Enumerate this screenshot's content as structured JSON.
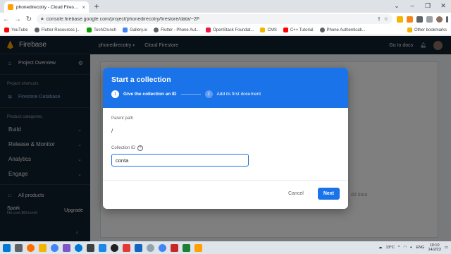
{
  "browser": {
    "tab_title": "phonedirecotry - Cloud Firestore",
    "url": "console.firebase.google.com/project/phonedirecotry/firestore/data/~2F",
    "bookmarks": [
      {
        "label": "YouTube",
        "color": "#ff0000"
      },
      {
        "label": "Flutter Resources |...",
        "color": "#5f6368"
      },
      {
        "label": "TechCrunch",
        "color": "#0a9e01"
      },
      {
        "label": "Gallery.io",
        "color": "#4285f4"
      },
      {
        "label": "Flutter - Phone Aut...",
        "color": "#5f6368"
      },
      {
        "label": "OpenStack Foundat...",
        "color": "#ed1944"
      },
      {
        "label": "CMS",
        "color": "#f4b400"
      },
      {
        "label": "C++ Tutorial",
        "color": "#ff0000"
      },
      {
        "label": "Phone Authenticati...",
        "color": "#5f6368"
      }
    ],
    "other_bookmarks": "Other bookmarks"
  },
  "sidebar": {
    "brand": "Firebase",
    "overview": "Project Overview",
    "shortcuts_label": "Project shortcuts",
    "firestore": "Firestore Database",
    "categories_label": "Product categories",
    "categories": [
      "Build",
      "Release & Monitor",
      "Analytics",
      "Engage"
    ],
    "all_products": "All products",
    "plan_name": "Spark",
    "plan_sub": "No-cost $0/month",
    "upgrade": "Upgrade"
  },
  "header": {
    "project": "phonedirecotry",
    "product": "Cloud Firestore",
    "docs": "Go to docs"
  },
  "main": {
    "no_data": "dd data."
  },
  "dialog": {
    "title": "Start a collection",
    "step1_num": "1",
    "step1_label": "Give the collection an ID",
    "step2_num": "2",
    "step2_label": "Add its first document",
    "parent_path_label": "Parent path",
    "parent_path_value": "/",
    "collection_id_label": "Collection ID",
    "help": "?",
    "collection_id_value": "conta",
    "cancel": "Cancel",
    "next": "Next"
  },
  "taskbar": {
    "temperature": "13°C",
    "lang": "ENG",
    "time": "10:10",
    "date": "14/2/23"
  }
}
